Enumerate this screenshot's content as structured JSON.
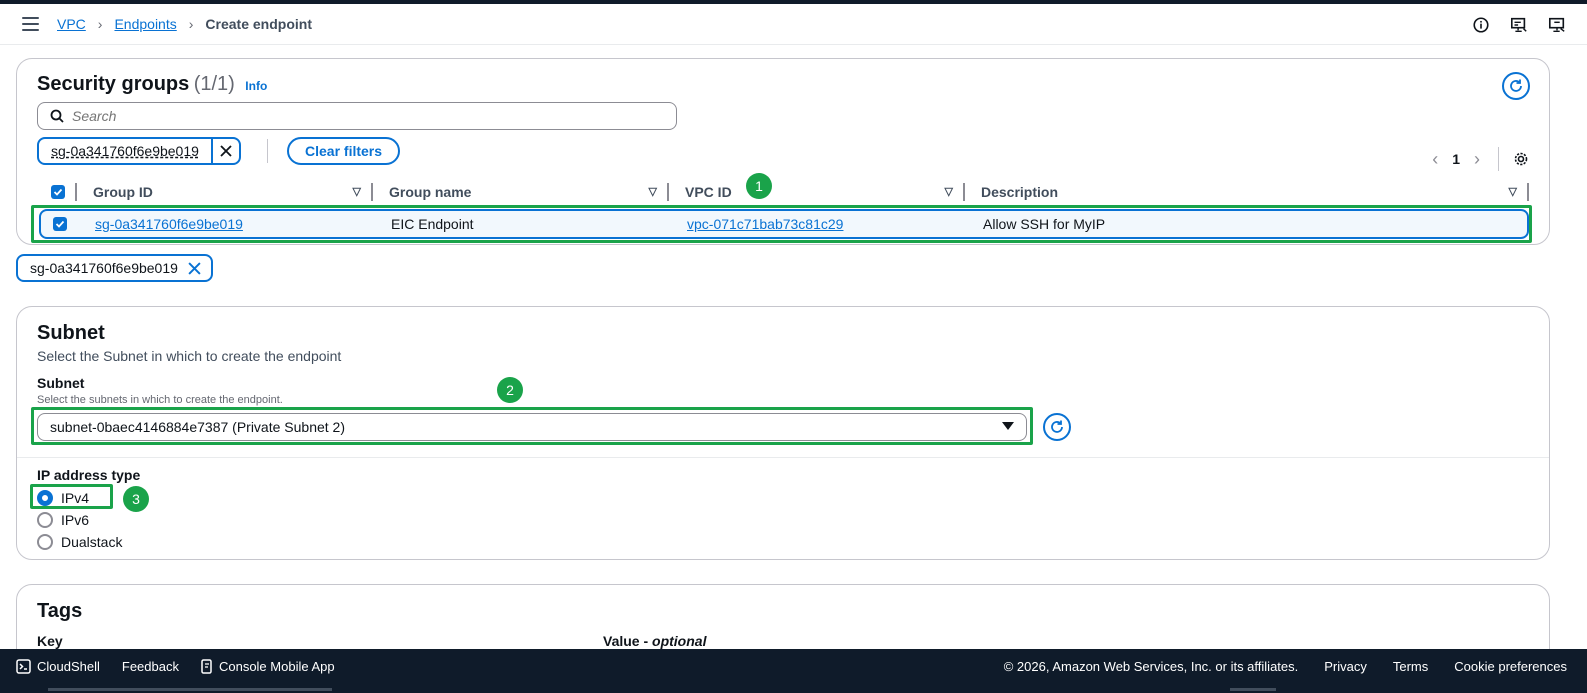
{
  "breadcrumb": {
    "items": [
      {
        "label": "VPC"
      },
      {
        "label": "Endpoints"
      }
    ],
    "current": "Create endpoint"
  },
  "security_groups": {
    "title": "Security groups",
    "count": "(1/1)",
    "info": "Info",
    "search_placeholder": "Search",
    "filter_token": "sg-0a341760f6e9be019",
    "clear_filters": "Clear filters",
    "page": "1",
    "columns": [
      "Group ID",
      "Group name",
      "VPC ID",
      "Description"
    ],
    "rows": [
      {
        "group_id": "sg-0a341760f6e9be019",
        "group_name": "EIC Endpoint",
        "vpc_id": "vpc-071c71bab73c81c29",
        "description": "Allow SSH for MyIP"
      }
    ],
    "selected_token": "sg-0a341760f6e9be019"
  },
  "subnet": {
    "title": "Subnet",
    "subtitle": "Select the Subnet in which to create the endpoint",
    "field_label": "Subnet",
    "field_desc": "Select the subnets in which to create the endpoint.",
    "selected": "subnet-0baec4146884e7387 (Private Subnet 2)",
    "ip_label": "IP address type",
    "ip_options": [
      "IPv4",
      "IPv6",
      "Dualstack"
    ],
    "ip_selected": "IPv4"
  },
  "tags": {
    "title": "Tags",
    "key_label": "Key",
    "value_label": "Value - ",
    "value_optional": "optional"
  },
  "annotations": [
    "1",
    "2",
    "3"
  ],
  "footer": {
    "cloudshell": "CloudShell",
    "feedback": "Feedback",
    "mobile_app": "Console Mobile App",
    "copyright": "© 2026, Amazon Web Services, Inc. or its affiliates.",
    "privacy": "Privacy",
    "terms": "Terms",
    "cookies": "Cookie preferences"
  },
  "colors": {
    "accent": "#0972d3",
    "annotation_green": "#1aa34a",
    "footer_bg": "#0f1b2a"
  }
}
